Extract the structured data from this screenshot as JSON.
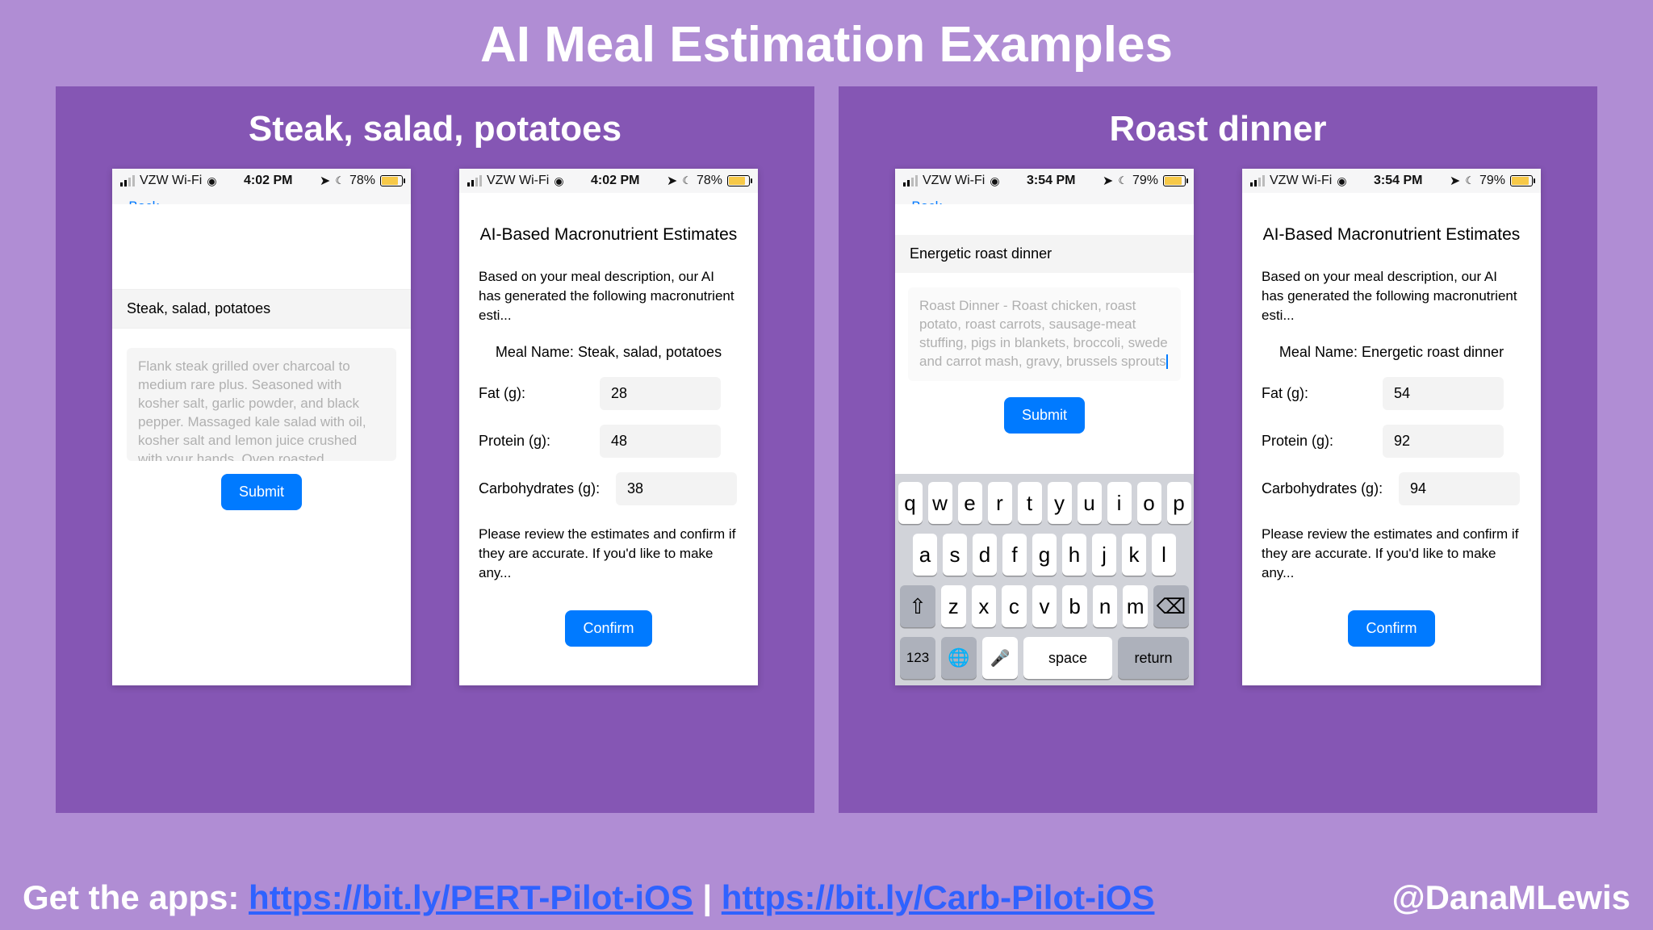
{
  "slide": {
    "title": "AI Meal Estimation Examples",
    "left_panel_title": "Steak, salad, potatoes",
    "right_panel_title": "Roast dinner"
  },
  "statusbar": {
    "carrier": "VZW Wi-Fi",
    "time_a": "4:02 PM",
    "time_b": "3:54 PM",
    "battery_a": "78%",
    "battery_b": "79%",
    "back_label": "Back"
  },
  "steak_input": {
    "meal_title": "Steak, salad, potatoes",
    "description": "Flank steak grilled over charcoal to medium rare plus. Seasoned with kosher salt, garlic powder, and black pepper. Massaged kale salad with oil, kosher salt and lemon juice crushed with your hands. Oven roasted",
    "submit_label": "Submit"
  },
  "results_common": {
    "title": "AI-Based Macronutrient Estimates",
    "intro": "Based on your meal description, our AI has generated the following macronutrient esti...",
    "meal_name_prefix": "Meal Name: ",
    "fat_label": "Fat (g):",
    "protein_label": "Protein (g):",
    "carb_label": "Carbohydrates (g):",
    "outro": "Please review the estimates and confirm if they are accurate. If you'd like to make any...",
    "confirm_label": "Confirm"
  },
  "steak_results": {
    "meal_name": "Steak, salad, potatoes",
    "fat": "28",
    "protein": "48",
    "carb": "38"
  },
  "roast_input": {
    "meal_title": "Energetic roast dinner",
    "description": "Roast Dinner - Roast chicken, roast potato, roast carrots, sausage-meat stuffing, pigs in blankets, broccoli, swede and carrot mash, gravy, brussels sprouts",
    "submit_label": "Submit"
  },
  "roast_results": {
    "meal_name": "Energetic roast dinner",
    "fat": "54",
    "protein": "92",
    "carb": "94"
  },
  "keyboard": {
    "row1": [
      "q",
      "w",
      "e",
      "r",
      "t",
      "y",
      "u",
      "i",
      "o",
      "p"
    ],
    "row2": [
      "a",
      "s",
      "d",
      "f",
      "g",
      "h",
      "j",
      "k",
      "l"
    ],
    "row3": [
      "z",
      "x",
      "c",
      "v",
      "b",
      "n",
      "m"
    ],
    "shift": "⇧",
    "backspace": "⌫",
    "k123": "123",
    "globe": "🌐",
    "mic": "🎤",
    "space": "space",
    "return": "return"
  },
  "footer": {
    "prefix": "Get the apps: ",
    "link1": "https://bit.ly/PERT-Pilot-iOS",
    "sep": " | ",
    "link2": "https://bit.ly/Carb-Pilot-iOS",
    "handle": "@DanaMLewis"
  }
}
